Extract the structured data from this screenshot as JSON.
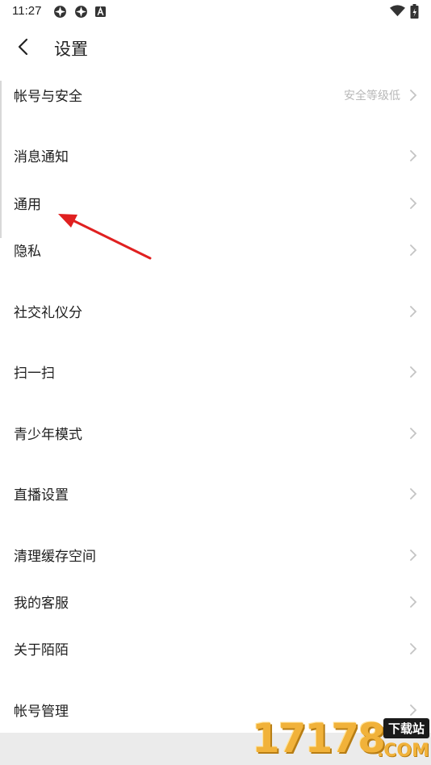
{
  "status_bar": {
    "time": "11:27"
  },
  "header": {
    "title": "设置"
  },
  "settings": [
    {
      "label": "帐号与安全",
      "hint": "安全等级低"
    },
    {
      "label": "消息通知"
    },
    {
      "label": "通用"
    },
    {
      "label": "隐私"
    },
    {
      "label": "社交礼仪分"
    },
    {
      "label": "扫一扫"
    },
    {
      "label": "青少年模式"
    },
    {
      "label": "直播设置"
    },
    {
      "label": "清理缓存空间"
    },
    {
      "label": "我的客服"
    },
    {
      "label": "关于陌陌"
    },
    {
      "label": "帐号管理"
    }
  ],
  "annotation": {
    "arrow_color": "#e02020"
  },
  "watermark": {
    "number": "17178",
    "tag": "下载站",
    "domain": ".COM"
  }
}
